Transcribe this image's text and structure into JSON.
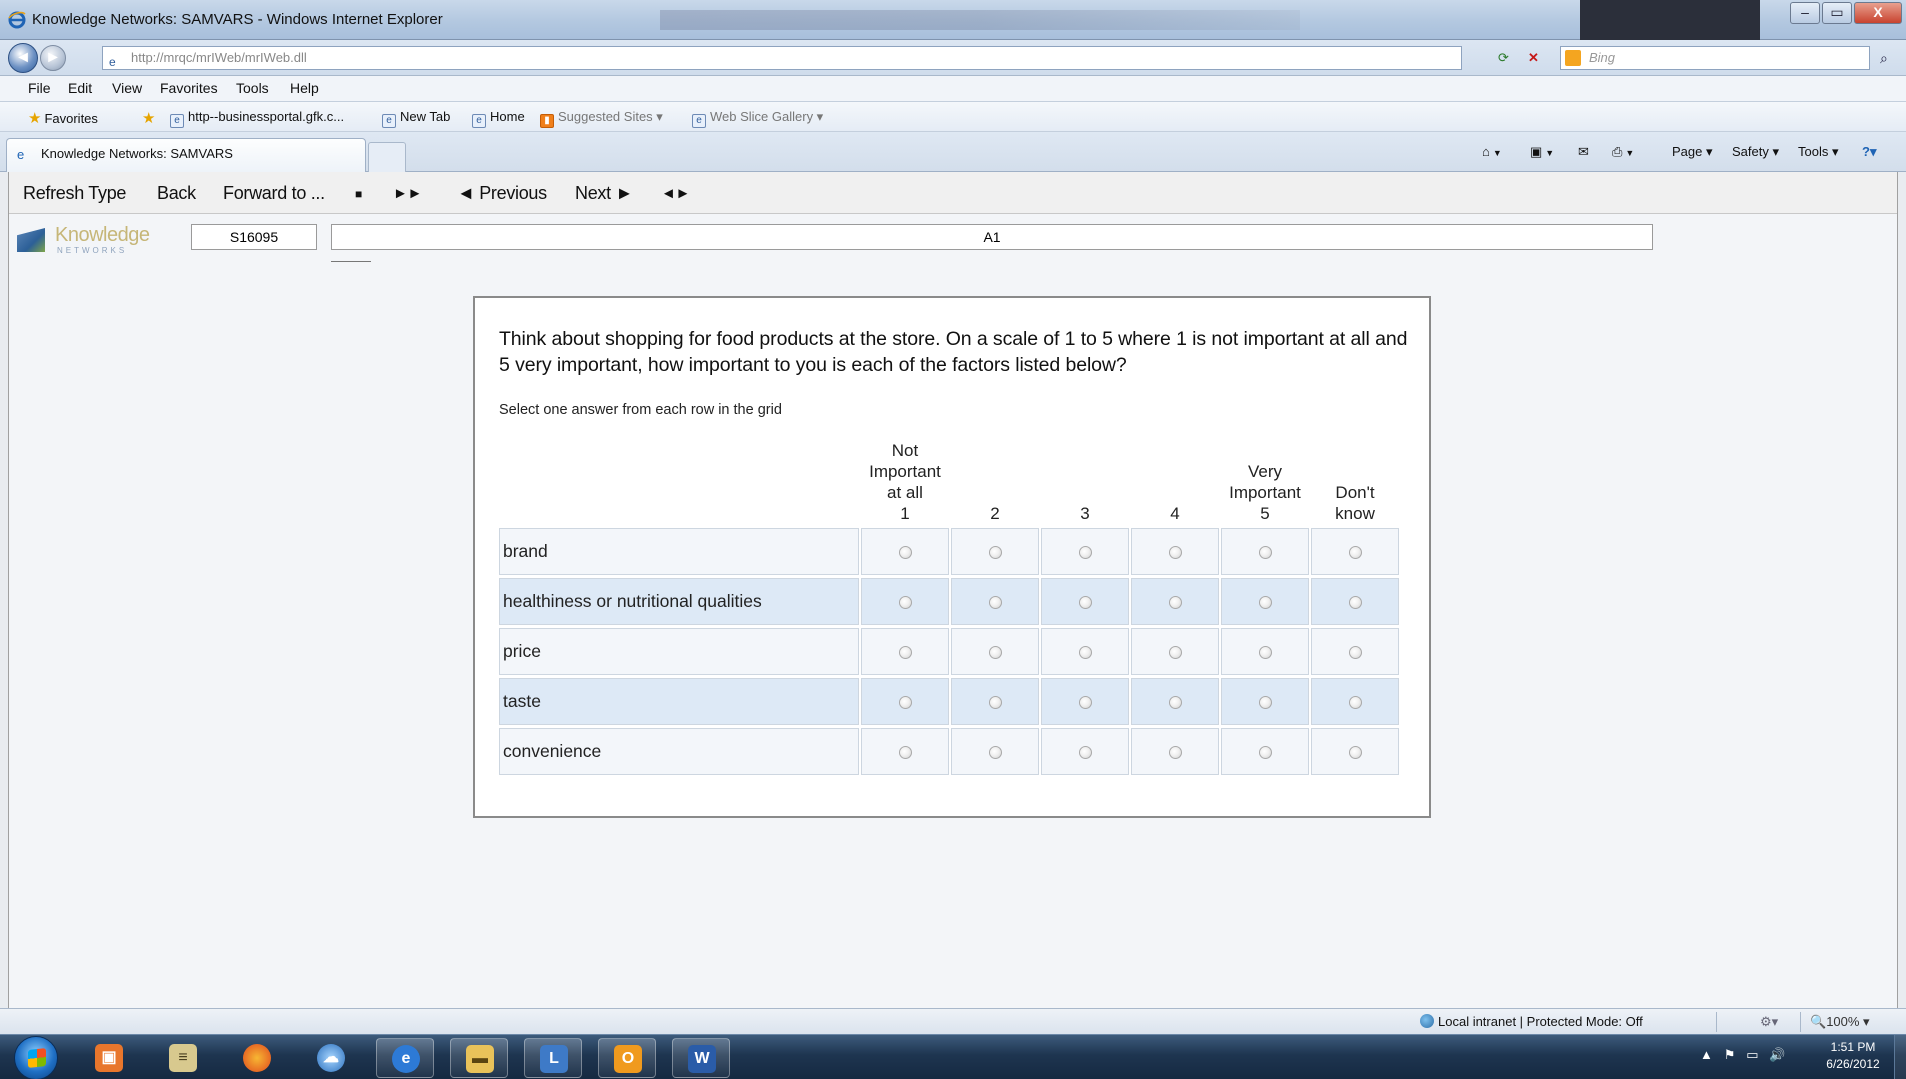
{
  "window": {
    "title": "Knowledge Networks: SAMVARS - Windows Internet Explorer",
    "minimize": "–",
    "maximize": "▭",
    "close": "X"
  },
  "address_bar": {
    "url": "http://mrqc/mrIWeb/mrIWeb.dll",
    "search_placeholder": "Bing"
  },
  "menu": [
    "File",
    "Edit",
    "View",
    "Favorites",
    "Tools",
    "Help"
  ],
  "favorites_bar": {
    "favorites_label": "Favorites",
    "items": [
      "http--businessportal.gfk.c...",
      "New Tab",
      "Home",
      "Suggested Sites ▾",
      "Web Slice Gallery ▾"
    ]
  },
  "tab": {
    "label": "Knowledge Networks: SAMVARS"
  },
  "command_bar": [
    "Page ▾",
    "Safety ▾",
    "Tools ▾"
  ],
  "app_toolbar": {
    "refresh_type": "Refresh Type",
    "back": "Back",
    "forward_to": "Forward to ...",
    "stop": "■",
    "fast_forward": "►►",
    "previous": "◄ Previous",
    "next": "Next ►",
    "prev_next": "◄►"
  },
  "logo": {
    "name": "Knowledge",
    "sub": "NETWORKS"
  },
  "ids": {
    "survey_id": "S16095",
    "question_id": "A1"
  },
  "survey": {
    "question": "Think about shopping for food products at the store. On a scale of 1 to 5 where 1 is not important at all and 5 very important, how important to you is each of the factors listed below?",
    "instruction": "Select one answer from each row in the grid",
    "columns": [
      [
        "Not",
        "Important",
        "at all",
        "1"
      ],
      [
        "2"
      ],
      [
        "3"
      ],
      [
        "4"
      ],
      [
        "Very",
        "Important",
        "5"
      ],
      [
        "Don't",
        "know"
      ]
    ],
    "rows": [
      "brand",
      "healthiness or nutritional qualities",
      "price",
      "taste",
      "convenience"
    ]
  },
  "status_bar": {
    "zone": "Local intranet | Protected Mode: Off",
    "zoom": "100%"
  },
  "taskbar": {
    "time": "1:51 PM",
    "date": "6/26/2012"
  },
  "colors": {
    "row_light": "#f3f6fa",
    "row_dark": "#dde9f6",
    "logo_gold": "#c6b678",
    "logo_blue": "#2c5f97"
  }
}
